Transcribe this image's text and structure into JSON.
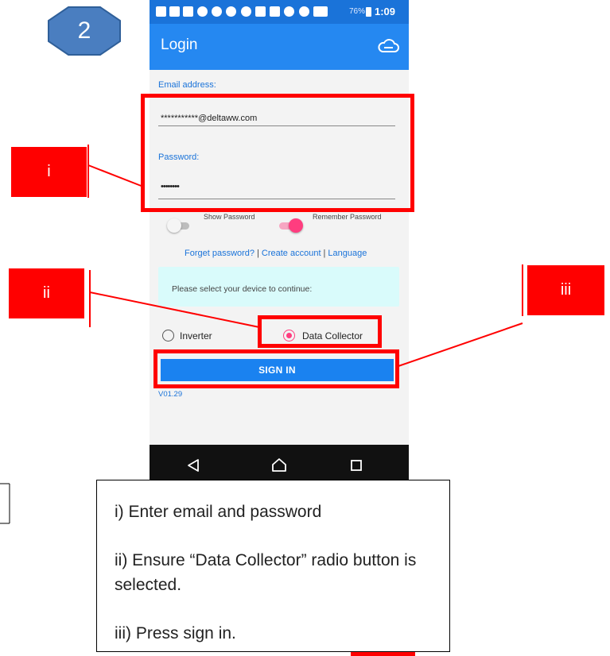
{
  "step": {
    "number": "2"
  },
  "status_bar": {
    "battery": "76%",
    "time": "1:09"
  },
  "app": {
    "title": "Login",
    "email_label": "Email address:",
    "email_value": "***********@deltaww.com",
    "password_label": "Password:",
    "password_value": "••••••••",
    "show_password_label": "Show Password",
    "show_password_on": false,
    "remember_password_label": "Remember Password",
    "remember_password_on": true,
    "links": {
      "forget_password": "Forget password?",
      "separator": "|",
      "create_account": "Create account",
      "language": "Language"
    },
    "device_prompt": "Please select your device to continue:",
    "device_options": [
      {
        "label": "Inverter",
        "selected": false
      },
      {
        "label": "Data Collector",
        "selected": true
      }
    ],
    "sign_in_label": "SIGN IN",
    "version": "V01.29"
  },
  "nav_bar": {
    "icons": [
      "back-icon",
      "home-icon",
      "recents-icon"
    ]
  },
  "annotations": {
    "labels": [
      "i",
      "ii",
      "iii"
    ]
  },
  "instructions": [
    "i) Enter email and password",
    "ii) Ensure “Data Collector” radio button is selected.",
    "iii) Press sign in."
  ],
  "colors": {
    "accent": "#2588f1",
    "status_bar": "#1a73d9",
    "annotation": "#ff0000",
    "toggle_on": "#ff3d7f",
    "badge": "#4a7ec0"
  }
}
